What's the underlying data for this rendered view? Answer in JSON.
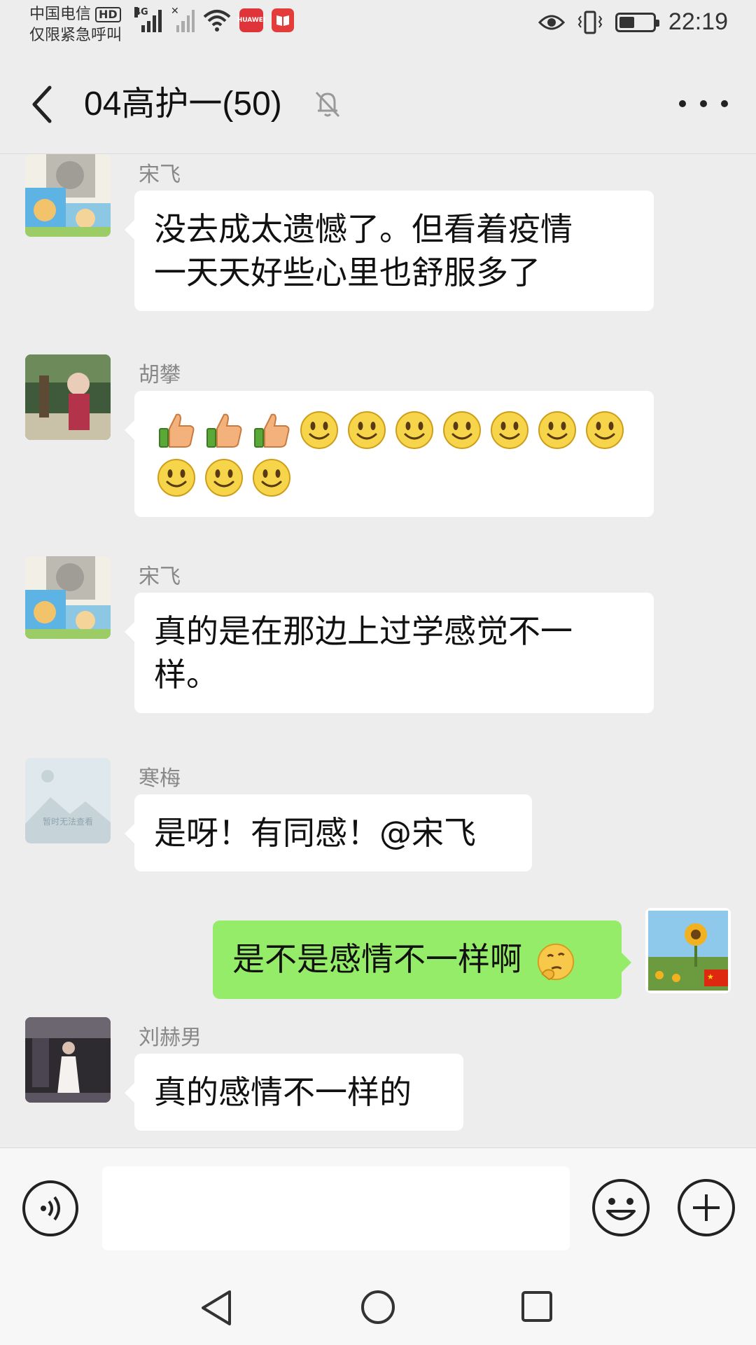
{
  "status_bar": {
    "carrier": "中国电信",
    "hd": "HD",
    "emergency": "仅限紧急呼叫",
    "network": "4G",
    "app_badge_text": "HUAWEI",
    "time": "22:19",
    "battery_level": 0.45
  },
  "header": {
    "title": "04高护一(50)",
    "icons": [
      "back-chevron-icon",
      "mute-bell-icon",
      "more-dots-icon"
    ]
  },
  "messages": [
    {
      "sender": "宋飞",
      "side": "left",
      "lines": [
        "没去成太遗憾了。但看着疫情",
        "一天天好些心里也舒服多了"
      ]
    },
    {
      "sender": "胡攀",
      "side": "left",
      "emoji": [
        "thumbs-up",
        "thumbs-up",
        "thumbs-up",
        "smile",
        "smile",
        "smile",
        "smile",
        "smile",
        "smile",
        "smile",
        "smile",
        "smile",
        "smile"
      ]
    },
    {
      "sender": "宋飞",
      "side": "left",
      "lines": [
        "真的是在那边上过学感觉不一",
        "样。"
      ]
    },
    {
      "sender": "寒梅",
      "side": "left",
      "text": "是呀！有同感！@宋飞",
      "avatar_placeholder": "暂时无法查看"
    },
    {
      "sender": "",
      "side": "right",
      "text": "是不是感情不一样啊",
      "trailing_emoji": "thinking-face"
    },
    {
      "sender": "刘赫男",
      "side": "left",
      "text": "真的感情不一样的"
    }
  ],
  "input_bar": {
    "placeholder": "",
    "icons": [
      "voice-icon",
      "emoji-face-icon",
      "plus-circle-icon"
    ]
  },
  "nav_bar": {
    "icons": [
      "nav-back-icon",
      "nav-home-icon",
      "nav-recent-icon"
    ]
  },
  "colors": {
    "background": "#ededed",
    "bubble_in": "#ffffff",
    "bubble_out": "#95ec69",
    "sender_name": "#888888"
  }
}
